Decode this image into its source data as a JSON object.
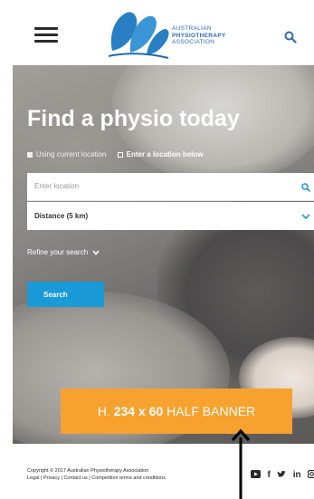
{
  "header": {
    "logo_lines": [
      "AUSTRALIAN",
      "PHYSIOTHERAPY",
      "ASSOCIATION"
    ]
  },
  "hero": {
    "title": "Find a physio today",
    "location_options": [
      "Using current location",
      "Enter a location below"
    ],
    "location_placeholder": "Enter location",
    "distance_value": "Distance (5 km)",
    "refine_label": "Refine your search",
    "search_label": "Search"
  },
  "banner": {
    "prefix": "H. ",
    "size": "234 x 60",
    "suffix": " HALF BANNER"
  },
  "footer": {
    "copyright": "Copyright © 2017 Australian Physiotherapy Association",
    "links": "Legal | Privacy | Contact us | Competition terms and conditions"
  },
  "colors": {
    "brand_blue": "#2a6bb5",
    "button_blue": "#1a9ad6",
    "banner_orange": "#f7a22f"
  }
}
